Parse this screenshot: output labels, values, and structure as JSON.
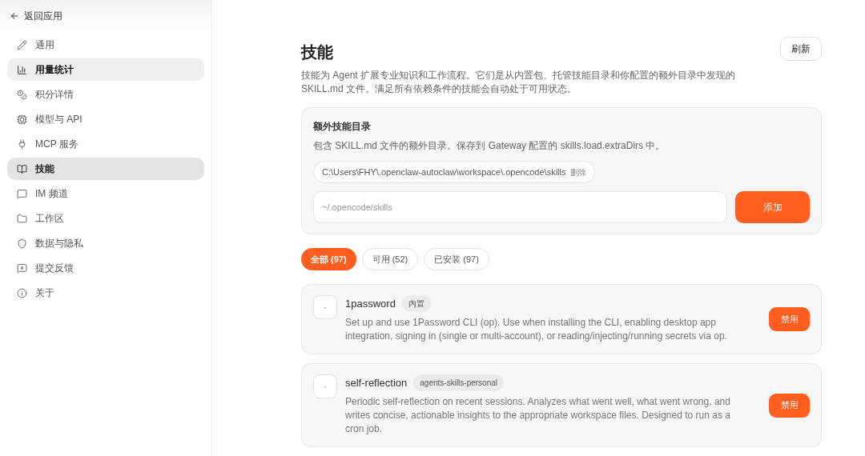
{
  "sidebar": {
    "back": "返回应用",
    "items": [
      {
        "label": "通用",
        "selected": false,
        "hovered": false
      },
      {
        "label": "用量统计",
        "selected": false,
        "hovered": true
      },
      {
        "label": "积分详情",
        "selected": false,
        "hovered": false
      },
      {
        "label": "模型与 API",
        "selected": false,
        "hovered": false
      },
      {
        "label": "MCP 服务",
        "selected": false,
        "hovered": false
      },
      {
        "label": "技能",
        "selected": true,
        "hovered": false
      },
      {
        "label": "IM 频道",
        "selected": false,
        "hovered": false
      },
      {
        "label": "工作区",
        "selected": false,
        "hovered": false
      },
      {
        "label": "数据与隐私",
        "selected": false,
        "hovered": false
      },
      {
        "label": "提交反馈",
        "selected": false,
        "hovered": false
      },
      {
        "label": "关于",
        "selected": false,
        "hovered": false
      }
    ]
  },
  "page": {
    "title": "技能",
    "refresh": "刷新",
    "description": "技能为 Agent 扩展专业知识和工作流程。它们是从内置包、托管技能目录和你配置的额外目录中发现的 SKILL.md 文件。满足所有依赖条件的技能会自动处于可用状态。"
  },
  "extra_dirs": {
    "title": "额外技能目录",
    "description": "包含 SKILL.md 文件的额外目录。保存到 Gateway 配置的 skills.load.extraDirs 中。",
    "dirs": [
      {
        "path": "C:\\Users\\FHY\\.openclaw-autoclaw\\workspace\\.opencode\\skills",
        "remove": "删除"
      }
    ],
    "input": {
      "placeholder": "~/.opencode/skills"
    },
    "add": "添加"
  },
  "filters": [
    {
      "label": "全部 (97)",
      "selected": true
    },
    {
      "label": "可用 (52)",
      "selected": false
    },
    {
      "label": "已安装 (97)",
      "selected": false
    }
  ],
  "skills": [
    {
      "icon": "·",
      "name": "1password",
      "tag": "内置",
      "description": "Set up and use 1Password CLI (op). Use when installing the CLI, enabling desktop app integration, signing in (single or multi-account), or reading/injecting/running secrets via op.",
      "action": "禁用"
    },
    {
      "icon": "·",
      "name": "self-reflection",
      "tag": "agents-skills-personal",
      "description": "Periodic self-reflection on recent sessions. Analyzes what went well, what went wrong, and writes concise, actionable insights to the appropriate workspace files. Designed to run as a cron job.",
      "action": "禁用"
    }
  ]
}
